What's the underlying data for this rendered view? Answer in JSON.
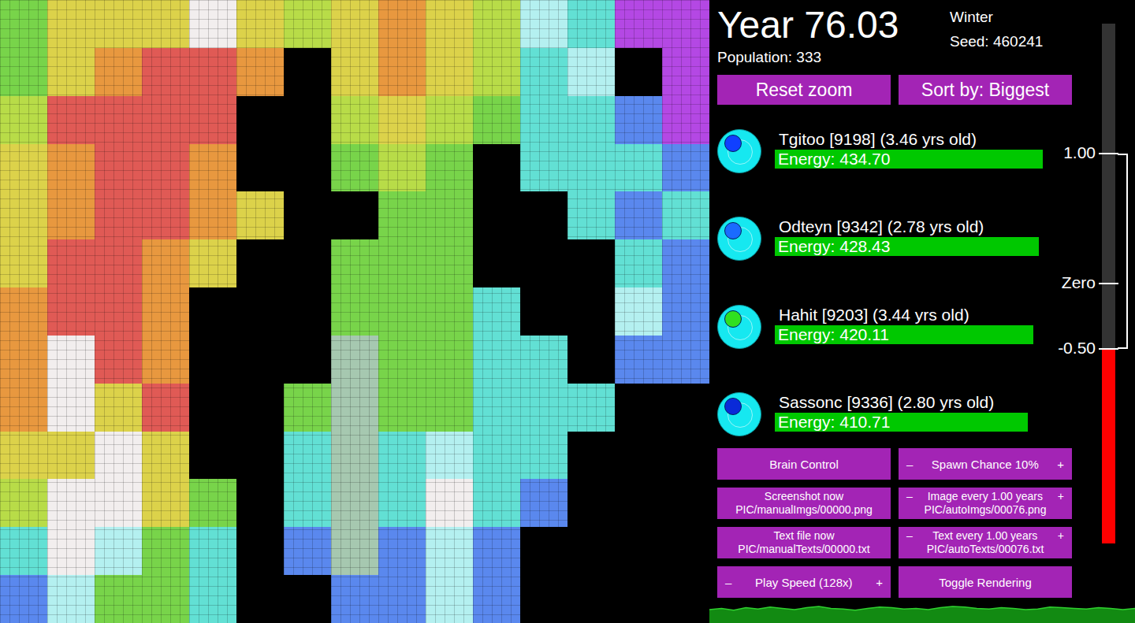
{
  "map": {
    "rows": [
      [
        "#78d44a",
        "#dcd24a",
        "#dcd24a",
        "#dcd24a",
        "#f2eeee",
        "#dcd24a",
        "#b8dc48",
        "#dcd24a",
        "#e8983f",
        "#dcd24a",
        "#b8dc48",
        "#b4f0f0",
        "#62e0d4",
        "#b448e4",
        "#b448e4"
      ],
      [
        "#78d44a",
        "#dcd24a",
        "#e8983f",
        "#e05a55",
        "#e05a55",
        "#e8983f",
        "#000000",
        "#dcd24a",
        "#e8983f",
        "#dcd24a",
        "#b8dc48",
        "#62e0d4",
        "#b4f0f0",
        "#000000",
        "#b448e4"
      ],
      [
        "#b8dc48",
        "#e05a55",
        "#e05a55",
        "#e05a55",
        "#e05a55",
        "#000000",
        "#000000",
        "#b8dc48",
        "#dcd24a",
        "#b8dc48",
        "#78d44a",
        "#62e0d4",
        "#62e0d4",
        "#5a88ee",
        "#b448e4"
      ],
      [
        "#dcd24a",
        "#e8983f",
        "#e05a55",
        "#e05a55",
        "#e8983f",
        "#000000",
        "#000000",
        "#78d44a",
        "#b8dc48",
        "#78d44a",
        "#000000",
        "#62e0d4",
        "#62e0d4",
        "#62e0d4",
        "#5a88ee"
      ],
      [
        "#dcd24a",
        "#e8983f",
        "#e05a55",
        "#e05a55",
        "#e8983f",
        "#dcd24a",
        "#000000",
        "#000000",
        "#78d44a",
        "#78d44a",
        "#000000",
        "#000000",
        "#62e0d4",
        "#5a88ee",
        "#62e0d4"
      ],
      [
        "#dcd24a",
        "#e05a55",
        "#e05a55",
        "#e8983f",
        "#dcd24a",
        "#000000",
        "#000000",
        "#78d44a",
        "#78d44a",
        "#78d44a",
        "#000000",
        "#000000",
        "#000000",
        "#62e0d4",
        "#5a88ee"
      ],
      [
        "#e8983f",
        "#e05a55",
        "#e05a55",
        "#e8983f",
        "#000000",
        "#000000",
        "#000000",
        "#78d44a",
        "#78d44a",
        "#78d44a",
        "#62e0d4",
        "#000000",
        "#000000",
        "#b4f0f0",
        "#5a88ee"
      ],
      [
        "#e8983f",
        "#f2eeee",
        "#e05a55",
        "#e8983f",
        "#000000",
        "#000000",
        "#000000",
        "#a6c8b0",
        "#78d44a",
        "#78d44a",
        "#62e0d4",
        "#62e0d4",
        "#000000",
        "#5a88ee",
        "#5a88ee"
      ],
      [
        "#e8983f",
        "#f2eeee",
        "#dcd24a",
        "#e05a55",
        "#000000",
        "#000000",
        "#78d44a",
        "#a6c8b0",
        "#78d44a",
        "#78d44a",
        "#62e0d4",
        "#62e0d4",
        "#62e0d4",
        "#000000",
        "#000000"
      ],
      [
        "#dcd24a",
        "#dcd24a",
        "#f2eeee",
        "#dcd24a",
        "#000000",
        "#000000",
        "#62e0d4",
        "#a6c8b0",
        "#62e0d4",
        "#b4f0f0",
        "#62e0d4",
        "#62e0d4",
        "#000000",
        "#000000",
        "#000000"
      ],
      [
        "#b8dc48",
        "#f2eeee",
        "#f2eeee",
        "#dcd24a",
        "#78d44a",
        "#000000",
        "#62e0d4",
        "#a6c8b0",
        "#62e0d4",
        "#f2eeee",
        "#62e0d4",
        "#5a88ee",
        "#000000",
        "#000000",
        "#000000"
      ],
      [
        "#62e0d4",
        "#f2eeee",
        "#b4f0f0",
        "#78d44a",
        "#62e0d4",
        "#000000",
        "#5a88ee",
        "#a6c8b0",
        "#5a88ee",
        "#b4f0f0",
        "#5a88ee",
        "#000000",
        "#000000",
        "#000000",
        "#000000"
      ],
      [
        "#5a88ee",
        "#b4f0f0",
        "#78d44a",
        "#78d44a",
        "#62e0d4",
        "#000000",
        "#000000",
        "#5a88ee",
        "#5a88ee",
        "#b4f0f0",
        "#5a88ee",
        "#000000",
        "#000000",
        "#000000",
        "#000000"
      ]
    ]
  },
  "header": {
    "year": "Year 76.03",
    "population": "Population: 333",
    "season": "Winter",
    "seed": "Seed: 460241"
  },
  "top_buttons": [
    "Reset zoom",
    "Sort by: Biggest"
  ],
  "creatures": [
    {
      "name": "Tgitoo [9198] (3.46 yrs old)",
      "energy": "Energy: 434.70",
      "level": 0.63,
      "color": "#1040ff"
    },
    {
      "name": "Odteyn [9342] (2.78 yrs old)",
      "energy": "Energy: 428.43",
      "level": 0.62,
      "color": "#1a6bff"
    },
    {
      "name": "Hahit [9203] (3.44 yrs old)",
      "energy": "Energy: 420.11",
      "level": 0.607,
      "color": "#30e020"
    },
    {
      "name": "Sassonc [9336] (2.80 yrs old)",
      "energy": "Energy: 410.71",
      "level": 0.594,
      "color": "#0a2ad8"
    }
  ],
  "controls": [
    {
      "kind": "plain",
      "label": "Brain Control"
    },
    {
      "kind": "stepper",
      "minus": "–",
      "label": "Spawn Chance 10%",
      "plus": "+"
    },
    {
      "kind": "plain",
      "label": "Screenshot now",
      "sub": "PIC/manualImgs/00000.png"
    },
    {
      "kind": "stepper",
      "minus": "–",
      "label": "Image every 1.00 years",
      "plus": "+",
      "sub": "PIC/autoImgs/00076.png"
    },
    {
      "kind": "plain",
      "label": "Text file now",
      "sub": "PIC/manualTexts/00000.txt"
    },
    {
      "kind": "stepper",
      "minus": "–",
      "label": "Text every 1.00 years",
      "plus": "+",
      "sub": "PIC/autoTexts/00076.txt"
    },
    {
      "kind": "stepper",
      "minus": "–",
      "label": "Play Speed (128x)",
      "plus": "+"
    },
    {
      "kind": "plain",
      "label": "Toggle Rendering"
    }
  ],
  "gauge": {
    "min": -2,
    "max": 2,
    "level": 0.375,
    "ticks": [
      {
        "label": "1.00",
        "value": 1
      },
      {
        "label": "Zero",
        "value": 0
      },
      {
        "label": "-0.50",
        "value": -0.5
      }
    ]
  },
  "population_graph": {
    "values": [
      331,
      333,
      330,
      334,
      332,
      335,
      333,
      331,
      334,
      336,
      333,
      332,
      330,
      333,
      335,
      334,
      332,
      333,
      331,
      334,
      336,
      335,
      333,
      332,
      334,
      333,
      331,
      332,
      335,
      334,
      333,
      332,
      334,
      333,
      331,
      333
    ]
  }
}
